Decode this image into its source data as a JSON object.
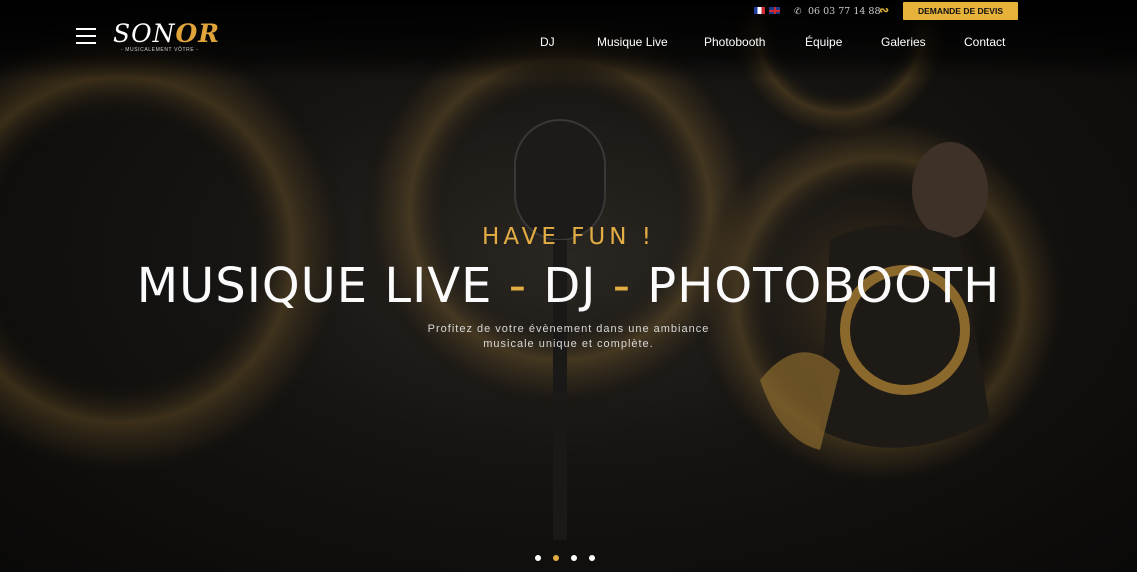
{
  "header": {
    "logo": {
      "text_white": "SON",
      "text_gold": "OR",
      "tagline": "- MUSICALEMENT VÔTRE -"
    },
    "languages": [
      {
        "code": "fr",
        "icon": "flag-fr-icon"
      },
      {
        "code": "en",
        "icon": "flag-uk-icon"
      }
    ],
    "phone": "06 03 77 14 88",
    "quote_button": "DEMANDE DE DEVIS",
    "nav": [
      "DJ",
      "Musique Live",
      "Photobooth",
      "Équipe",
      "Galeries",
      "Contact"
    ]
  },
  "hero": {
    "tagline": "HAVE FUN !",
    "headline": {
      "part1": "MUSIQUE LIVE",
      "sep": "-",
      "part2": "DJ",
      "part3": "PHOTOBOOTH"
    },
    "subtitle_line1": "Profitez de votre évènement dans une ambiance",
    "subtitle_line2": "musicale unique et complète.",
    "slides": 4,
    "active_slide": 2
  },
  "colors": {
    "accent": "#e3ad43",
    "background": "#0b0a09"
  }
}
